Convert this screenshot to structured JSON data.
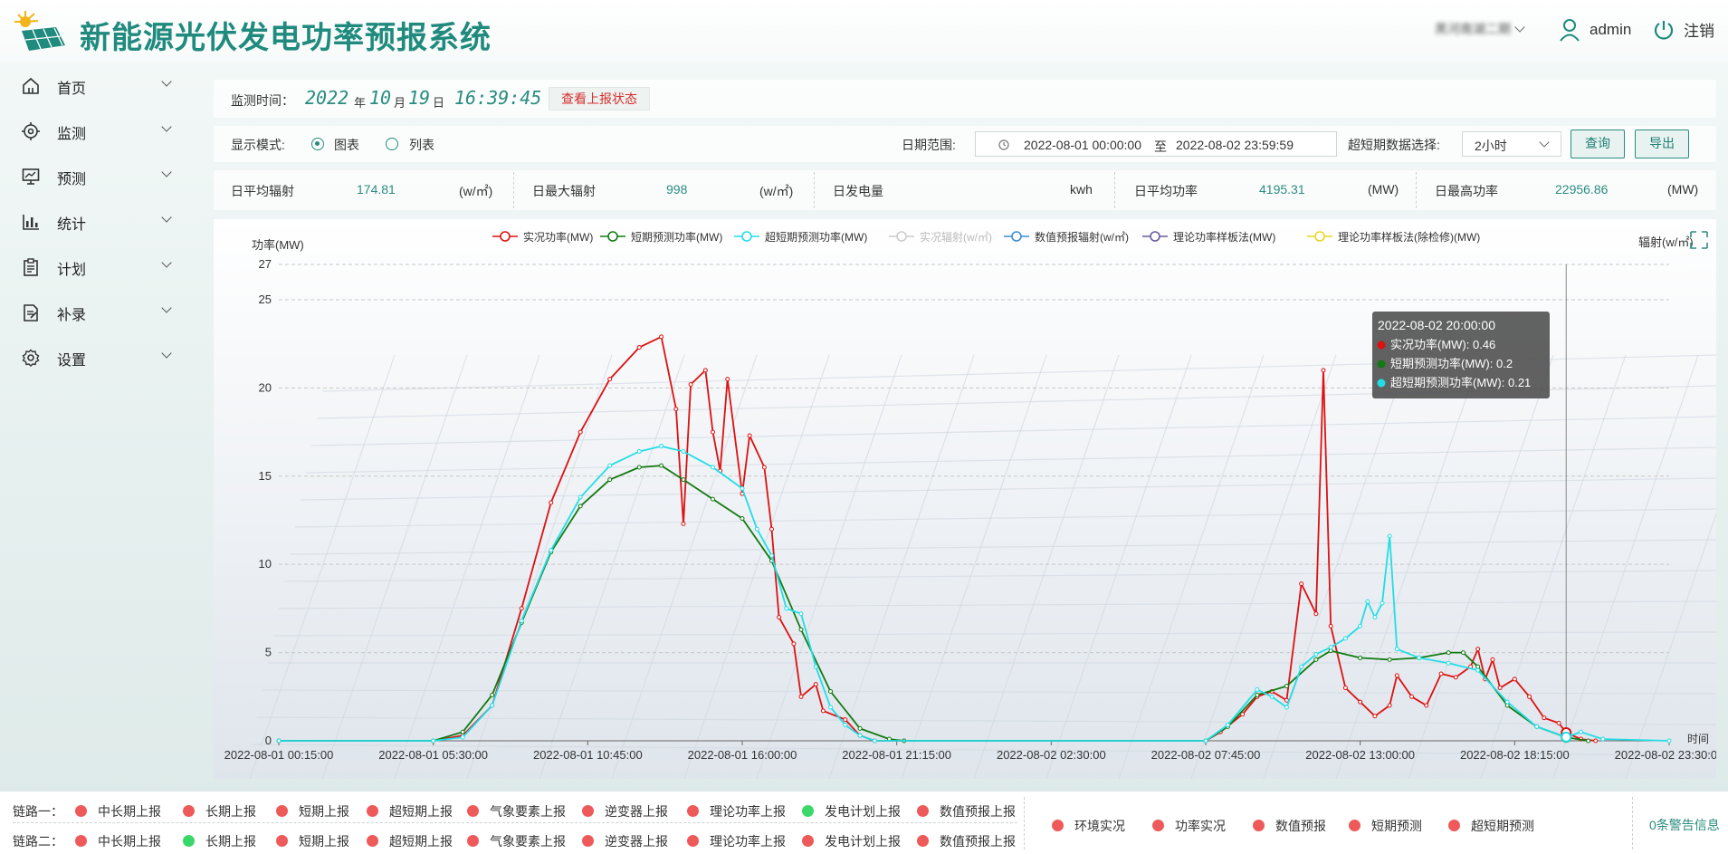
{
  "header": {
    "app_title": "新能源光伏发电功率预报系统",
    "station": "黑河南湖二期",
    "username": "admin",
    "logout_label": "注销"
  },
  "sidebar": {
    "items": [
      {
        "label": "首页",
        "icon": "home-icon"
      },
      {
        "label": "监测",
        "icon": "target-icon"
      },
      {
        "label": "预测",
        "icon": "monitor-chart-icon"
      },
      {
        "label": "统计",
        "icon": "bar-chart-icon"
      },
      {
        "label": "计划",
        "icon": "clipboard-icon"
      },
      {
        "label": "补录",
        "icon": "edit-doc-icon"
      },
      {
        "label": "设置",
        "icon": "gear-icon"
      }
    ]
  },
  "monitor": {
    "label": "监测时间：",
    "year": "2022",
    "year_unit": "年",
    "month": "10",
    "month_unit": "月",
    "day": "19",
    "day_unit": "日",
    "time": "16:39:45",
    "status_button": "查看上报状态"
  },
  "controls": {
    "display_label": "显示模式:",
    "mode_chart": "图表",
    "mode_list": "列表",
    "selected_mode": "图表",
    "date_label": "日期范围:",
    "date_start": "2022-08-01 00:00:00",
    "date_sep": "至",
    "date_end": "2022-08-02 23:59:59",
    "ultra_label": "超短期数据选择:",
    "ultra_value": "2小时",
    "query_button": "查询",
    "export_button": "导出"
  },
  "stats": [
    {
      "label": "日平均辐射",
      "value": "174.81",
      "unit": "(w/㎡)"
    },
    {
      "label": "日最大辐射",
      "value": "998",
      "unit": "(w/㎡)"
    },
    {
      "label": "日发电量",
      "value": "",
      "unit": "kwh"
    },
    {
      "label": "日平均功率",
      "value": "4195.31",
      "unit": "(MW)"
    },
    {
      "label": "日最高功率",
      "value": "22956.86",
      "unit": "(MW)"
    }
  ],
  "chart_data": {
    "type": "line",
    "ylabel": "功率(MW)",
    "y2label": "辐射(w/㎡)",
    "xlabel": "时间",
    "ylim": [
      0,
      27
    ],
    "yticks": [
      0,
      5,
      10,
      15,
      20,
      25,
      27
    ],
    "grid": true,
    "legend_position": "top",
    "x_labels": [
      "2022-08-01 00:15:00",
      "2022-08-01 05:30:00",
      "2022-08-01 10:45:00",
      "2022-08-01 16:00:00",
      "2022-08-01 21:15:00",
      "2022-08-02 02:30:00",
      "2022-08-02 07:45:00",
      "2022-08-02 13:00:00",
      "2022-08-02 18:15:00",
      "2022-08-02 23:30:00"
    ],
    "x_start": "2022-08-01 00:15:00",
    "x_end": "2022-08-02 23:30:00",
    "legend": [
      {
        "name": "实况功率(MW)",
        "color": "#dd1111",
        "enabled": true
      },
      {
        "name": "短期预测功率(MW)",
        "color": "#127a12",
        "enabled": true
      },
      {
        "name": "超短期预测功率(MW)",
        "color": "#22dde6",
        "enabled": true
      },
      {
        "name": "实况辐射(w/㎡)",
        "color": "#cccccc",
        "enabled": false
      },
      {
        "name": "数值预报辐射(w/㎡)",
        "color": "#3a8fd0",
        "enabled": true
      },
      {
        "name": "理论功率样板法(MW)",
        "color": "#6a5a9a",
        "enabled": true
      },
      {
        "name": "理论功率样板法(除检修)(MW)",
        "color": "#e6d820",
        "enabled": true
      }
    ],
    "series": [
      {
        "name": "实况功率(MW)",
        "color": "#dd1111",
        "points": [
          [
            "2022-08-01 00:15:00",
            0
          ],
          [
            "2022-08-01 05:30:00",
            0
          ],
          [
            "2022-08-01 06:30:00",
            0.3
          ],
          [
            "2022-08-01 07:30:00",
            2.0
          ],
          [
            "2022-08-01 08:30:00",
            7.5
          ],
          [
            "2022-08-01 09:30:00",
            13.5
          ],
          [
            "2022-08-01 10:30:00",
            17.5
          ],
          [
            "2022-08-01 11:30:00",
            20.5
          ],
          [
            "2022-08-01 12:30:00",
            22.3
          ],
          [
            "2022-08-01 13:15:00",
            22.9
          ],
          [
            "2022-08-01 13:45:00",
            18.8
          ],
          [
            "2022-08-01 14:00:00",
            12.3
          ],
          [
            "2022-08-01 14:15:00",
            20.2
          ],
          [
            "2022-08-01 14:45:00",
            21.0
          ],
          [
            "2022-08-01 15:00:00",
            17.5
          ],
          [
            "2022-08-01 15:15:00",
            15.3
          ],
          [
            "2022-08-01 15:30:00",
            20.5
          ],
          [
            "2022-08-01 16:00:00",
            14.0
          ],
          [
            "2022-08-01 16:15:00",
            17.3
          ],
          [
            "2022-08-01 16:45:00",
            15.5
          ],
          [
            "2022-08-01 17:00:00",
            12.0
          ],
          [
            "2022-08-01 17:15:00",
            7.0
          ],
          [
            "2022-08-01 17:45:00",
            5.5
          ],
          [
            "2022-08-01 18:00:00",
            2.5
          ],
          [
            "2022-08-01 18:30:00",
            3.2
          ],
          [
            "2022-08-01 18:45:00",
            1.7
          ],
          [
            "2022-08-01 19:30:00",
            1.2
          ],
          [
            "2022-08-01 20:00:00",
            0.3
          ],
          [
            "2022-08-01 20:30:00",
            0
          ],
          [
            "2022-08-02 07:45:00",
            0
          ],
          [
            "2022-08-02 08:15:00",
            0.5
          ],
          [
            "2022-08-02 09:00:00",
            1.5
          ],
          [
            "2022-08-02 09:30:00",
            2.5
          ],
          [
            "2022-08-02 10:00:00",
            2.8
          ],
          [
            "2022-08-02 10:30:00",
            2.3
          ],
          [
            "2022-08-02 11:00:00",
            8.9
          ],
          [
            "2022-08-02 11:30:00",
            7.2
          ],
          [
            "2022-08-02 11:45:00",
            21.0
          ],
          [
            "2022-08-02 12:00:00",
            6.5
          ],
          [
            "2022-08-02 12:30:00",
            3.0
          ],
          [
            "2022-08-02 13:00:00",
            2.2
          ],
          [
            "2022-08-02 13:30:00",
            1.4
          ],
          [
            "2022-08-02 14:00:00",
            2.0
          ],
          [
            "2022-08-02 14:15:00",
            3.7
          ],
          [
            "2022-08-02 14:45:00",
            2.5
          ],
          [
            "2022-08-02 15:15:00",
            2.0
          ],
          [
            "2022-08-02 15:45:00",
            3.8
          ],
          [
            "2022-08-02 16:15:00",
            3.6
          ],
          [
            "2022-08-02 16:45:00",
            4.2
          ],
          [
            "2022-08-02 17:00:00",
            5.2
          ],
          [
            "2022-08-02 17:15:00",
            3.5
          ],
          [
            "2022-08-02 17:30:00",
            4.6
          ],
          [
            "2022-08-02 17:45:00",
            3.0
          ],
          [
            "2022-08-02 18:15:00",
            3.5
          ],
          [
            "2022-08-02 18:45:00",
            2.5
          ],
          [
            "2022-08-02 19:15:00",
            1.3
          ],
          [
            "2022-08-02 19:45:00",
            1.0
          ],
          [
            "2022-08-02 20:00:00",
            0.46
          ],
          [
            "2022-08-02 20:30:00",
            0.1
          ],
          [
            "2022-08-02 21:00:00",
            0
          ]
        ]
      },
      {
        "name": "短期预测功率(MW)",
        "color": "#127a12",
        "points": [
          [
            "2022-08-01 00:15:00",
            0
          ],
          [
            "2022-08-01 05:30:00",
            0
          ],
          [
            "2022-08-01 06:30:00",
            0.5
          ],
          [
            "2022-08-01 07:30:00",
            2.6
          ],
          [
            "2022-08-01 08:30:00",
            6.7
          ],
          [
            "2022-08-01 09:30:00",
            10.7
          ],
          [
            "2022-08-01 10:30:00",
            13.3
          ],
          [
            "2022-08-01 11:30:00",
            14.8
          ],
          [
            "2022-08-01 12:30:00",
            15.5
          ],
          [
            "2022-08-01 13:15:00",
            15.6
          ],
          [
            "2022-08-01 14:00:00",
            14.8
          ],
          [
            "2022-08-01 15:00:00",
            13.7
          ],
          [
            "2022-08-01 16:00:00",
            12.6
          ],
          [
            "2022-08-01 17:00:00",
            10.2
          ],
          [
            "2022-08-01 18:00:00",
            6.3
          ],
          [
            "2022-08-01 19:00:00",
            2.8
          ],
          [
            "2022-08-01 20:00:00",
            0.7
          ],
          [
            "2022-08-01 21:00:00",
            0.1
          ],
          [
            "2022-08-01 21:30:00",
            0
          ],
          [
            "2022-08-02 07:45:00",
            0
          ],
          [
            "2022-08-02 08:30:00",
            0.8
          ],
          [
            "2022-08-02 09:30:00",
            2.6
          ],
          [
            "2022-08-02 10:30:00",
            3.1
          ],
          [
            "2022-08-02 11:30:00",
            4.6
          ],
          [
            "2022-08-02 12:00:00",
            5.1
          ],
          [
            "2022-08-02 13:00:00",
            4.7
          ],
          [
            "2022-08-02 14:00:00",
            4.6
          ],
          [
            "2022-08-02 15:00:00",
            4.7
          ],
          [
            "2022-08-02 16:00:00",
            5.0
          ],
          [
            "2022-08-02 16:30:00",
            5.0
          ],
          [
            "2022-08-02 17:00:00",
            4.2
          ],
          [
            "2022-08-02 18:00:00",
            2.0
          ],
          [
            "2022-08-02 19:00:00",
            0.8
          ],
          [
            "2022-08-02 20:00:00",
            0.2
          ],
          [
            "2022-08-02 20:45:00",
            0
          ]
        ]
      },
      {
        "name": "超短期预测功率(MW)",
        "color": "#22dde6",
        "points": [
          [
            "2022-08-01 00:15:00",
            0
          ],
          [
            "2022-08-01 05:30:00",
            0
          ],
          [
            "2022-08-01 06:30:00",
            0.2
          ],
          [
            "2022-08-01 07:30:00",
            2.0
          ],
          [
            "2022-08-01 08:30:00",
            6.8
          ],
          [
            "2022-08-01 09:30:00",
            10.8
          ],
          [
            "2022-08-01 10:30:00",
            13.8
          ],
          [
            "2022-08-01 11:30:00",
            15.6
          ],
          [
            "2022-08-01 12:30:00",
            16.4
          ],
          [
            "2022-08-01 13:15:00",
            16.7
          ],
          [
            "2022-08-01 14:00:00",
            16.4
          ],
          [
            "2022-08-01 15:00:00",
            15.5
          ],
          [
            "2022-08-01 16:00:00",
            14.3
          ],
          [
            "2022-08-01 16:30:00",
            12.0
          ],
          [
            "2022-08-01 17:00:00",
            10.5
          ],
          [
            "2022-08-01 17:30:00",
            7.5
          ],
          [
            "2022-08-01 18:00:00",
            7.2
          ],
          [
            "2022-08-01 18:30:00",
            4.2
          ],
          [
            "2022-08-01 19:00:00",
            1.9
          ],
          [
            "2022-08-01 19:30:00",
            0.9
          ],
          [
            "2022-08-01 20:00:00",
            0.3
          ],
          [
            "2022-08-01 20:30:00",
            0
          ],
          [
            "2022-08-02 07:45:00",
            0
          ],
          [
            "2022-08-02 08:30:00",
            0.9
          ],
          [
            "2022-08-02 09:30:00",
            2.9
          ],
          [
            "2022-08-02 10:00:00",
            2.5
          ],
          [
            "2022-08-02 10:30:00",
            1.9
          ],
          [
            "2022-08-02 11:00:00",
            4.2
          ],
          [
            "2022-08-02 11:30:00",
            4.9
          ],
          [
            "2022-08-02 12:00:00",
            5.3
          ],
          [
            "2022-08-02 12:30:00",
            5.8
          ],
          [
            "2022-08-02 13:00:00",
            6.5
          ],
          [
            "2022-08-02 13:15:00",
            7.9
          ],
          [
            "2022-08-02 13:30:00",
            7.0
          ],
          [
            "2022-08-02 13:45:00",
            7.8
          ],
          [
            "2022-08-02 14:00:00",
            11.6
          ],
          [
            "2022-08-02 14:15:00",
            5.2
          ],
          [
            "2022-08-02 15:00:00",
            4.7
          ],
          [
            "2022-08-02 16:00:00",
            4.4
          ],
          [
            "2022-08-02 17:00:00",
            4.0
          ],
          [
            "2022-08-02 18:00:00",
            2.2
          ],
          [
            "2022-08-02 19:00:00",
            0.8
          ],
          [
            "2022-08-02 20:00:00",
            0.21
          ],
          [
            "2022-08-02 20:30:00",
            0.5
          ],
          [
            "2022-08-02 21:15:00",
            0.1
          ],
          [
            "2022-08-02 23:30:00",
            0
          ]
        ]
      }
    ],
    "tooltip": {
      "time": "2022-08-02 20:00:00",
      "lines": [
        {
          "name": "实况功率(MW)",
          "value": "0.46",
          "color": "#dd1111"
        },
        {
          "name": "短期预测功率(MW)",
          "value": "0.2",
          "color": "#127a12"
        },
        {
          "name": "超短期预测功率(MW)",
          "value": "0.21",
          "color": "#22dde6"
        }
      ]
    }
  },
  "footer": {
    "link1_label": "链路一：",
    "link2_label": "链路二：",
    "link1": [
      {
        "label": "中长期上报",
        "status": "red"
      },
      {
        "label": "长期上报",
        "status": "red"
      },
      {
        "label": "短期上报",
        "status": "red"
      },
      {
        "label": "超短期上报",
        "status": "red"
      },
      {
        "label": "气象要素上报",
        "status": "red"
      },
      {
        "label": "逆变器上报",
        "status": "red"
      },
      {
        "label": "理论功率上报",
        "status": "red"
      },
      {
        "label": "发电计划上报",
        "status": "green"
      },
      {
        "label": "数值预报上报",
        "status": "red"
      }
    ],
    "link2": [
      {
        "label": "中长期上报",
        "status": "red"
      },
      {
        "label": "长期上报",
        "status": "green"
      },
      {
        "label": "短期上报",
        "status": "red"
      },
      {
        "label": "超短期上报",
        "status": "red"
      },
      {
        "label": "气象要素上报",
        "status": "red"
      },
      {
        "label": "逆变器上报",
        "status": "red"
      },
      {
        "label": "理论功率上报",
        "status": "red"
      },
      {
        "label": "发电计划上报",
        "status": "red"
      },
      {
        "label": "数值预报上报",
        "status": "red"
      }
    ],
    "realtime": [
      {
        "label": "环境实况",
        "status": "red"
      },
      {
        "label": "功率实况",
        "status": "red"
      },
      {
        "label": "数值预报",
        "status": "red"
      },
      {
        "label": "短期预测",
        "status": "red"
      },
      {
        "label": "超短期预测",
        "status": "red"
      }
    ],
    "warning": "0条警告信息",
    "status_colors": {
      "red": "#ee5a5a",
      "green": "#3ad86a"
    }
  }
}
